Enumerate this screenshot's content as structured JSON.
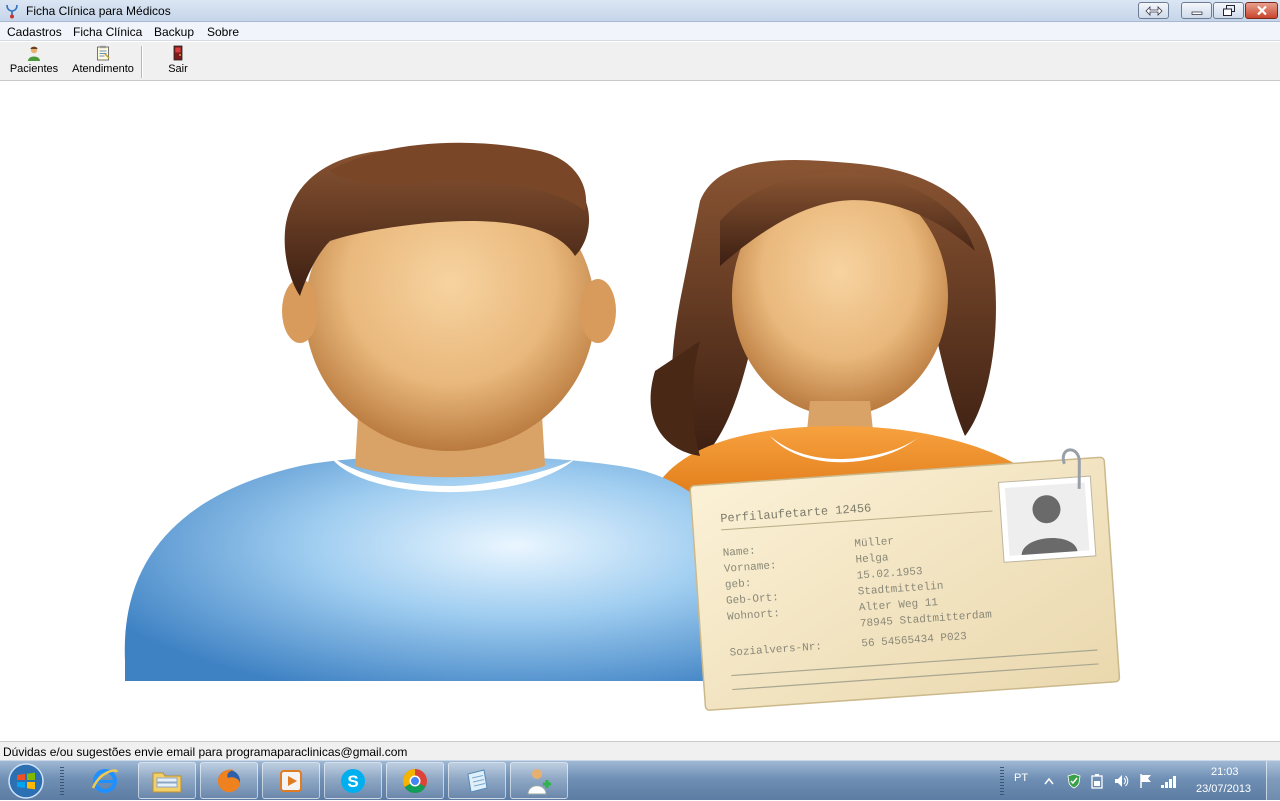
{
  "window": {
    "title": "Ficha Clínica para Médicos"
  },
  "menu": {
    "items": [
      "Cadastros",
      "Ficha Clínica",
      "Backup",
      "Sobre"
    ]
  },
  "toolbar": {
    "patients_label": "Pacientes",
    "service_label": "Atendimento",
    "exit_label": "Sair"
  },
  "card": {
    "heading": "Perfilaufetarte 12456",
    "rows": [
      {
        "label": "Name:",
        "value": "Müller"
      },
      {
        "label": "Vorname:",
        "value": "Helga"
      },
      {
        "label": "geb:",
        "value": "15.02.1953"
      },
      {
        "label": "Geb-Ort:",
        "value": "Stadtmittelin"
      },
      {
        "label": "Wohnort:",
        "value": "Alter Weg 11"
      },
      {
        "label": "",
        "value": "78945 Stadtmitterdam"
      },
      {
        "label": "Sozialvers-Nr:",
        "value": "56 54565434 P023"
      }
    ]
  },
  "status": {
    "message": "Dúvidas e/ou sugestões envie email para programaparaclinicas@gmail.com"
  },
  "taskbar": {
    "apps": [
      "internet-explorer",
      "file-explorer",
      "firefox",
      "media-player",
      "skype",
      "chrome",
      "notepad",
      "clinic-app"
    ],
    "language": "PT",
    "time": "21:03",
    "date": "23/07/2013"
  },
  "colors": {
    "titlebar": "#c5d5ea",
    "toolbar": "#f0f0f0",
    "man_shirt": "#8fc0e8",
    "woman_shirt": "#f29a3a",
    "skin": "#e9b87c",
    "hair": "#5a3320",
    "card": "#f3e6c4"
  }
}
